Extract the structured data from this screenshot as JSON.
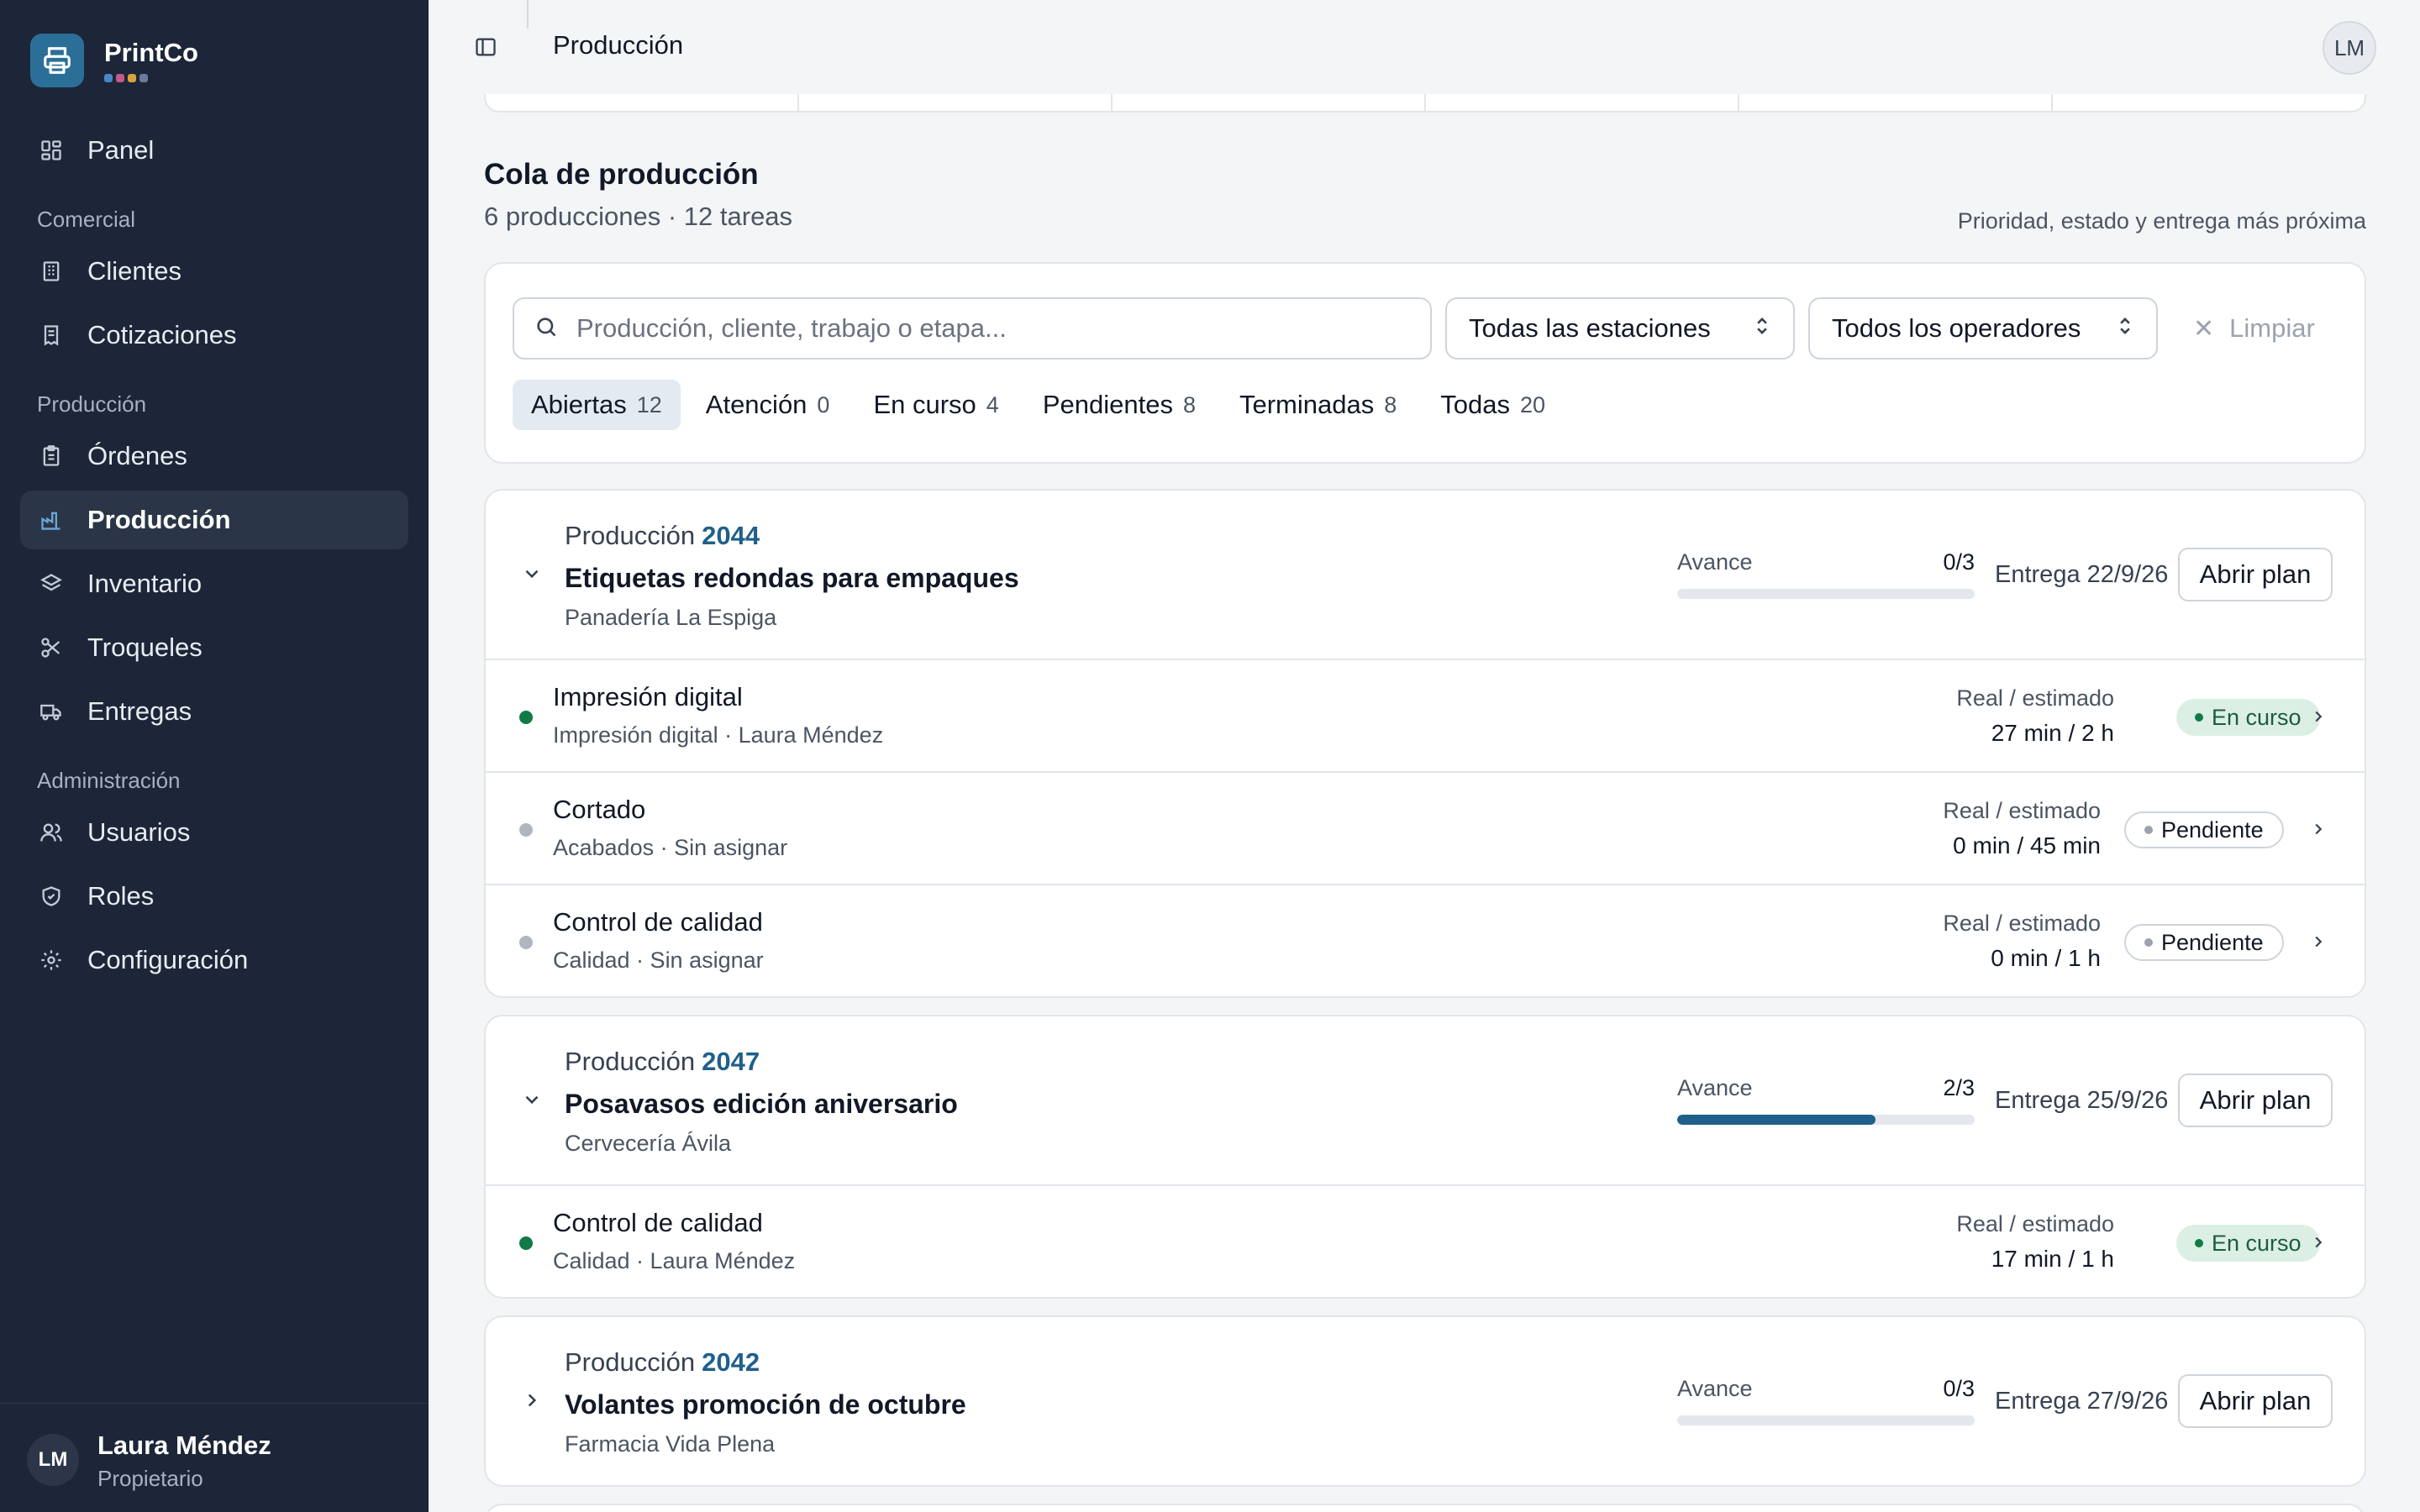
{
  "brand": {
    "name": "PrintCo",
    "dot_colors": [
      "#4a86c5",
      "#c55a8a",
      "#d9a23a",
      "#6b7c9a"
    ]
  },
  "nav": {
    "panel": "Panel",
    "section_comercial": "Comercial",
    "clientes": "Clientes",
    "cotizaciones": "Cotizaciones",
    "section_produccion": "Producción",
    "ordenes": "Órdenes",
    "produccion": "Producción",
    "inventario": "Inventario",
    "troqueles": "Troqueles",
    "entregas": "Entregas",
    "section_admin": "Administración",
    "usuarios": "Usuarios",
    "roles": "Roles",
    "configuracion": "Configuración"
  },
  "user": {
    "initials": "LM",
    "name": "Laura Méndez",
    "role": "Propietario"
  },
  "header": {
    "title": "Producción",
    "avatar_initials": "LM"
  },
  "queue": {
    "title": "Cola de producción",
    "subtitle": "6 producciones · 12 tareas",
    "sort_text": "Prioridad, estado y entrega más próxima"
  },
  "filters": {
    "search_placeholder": "Producción, cliente, trabajo o etapa...",
    "station": "Todas las estaciones",
    "operator": "Todos los operadores",
    "clear": "Limpiar",
    "tabs": [
      {
        "label": "Abiertas",
        "count": "12"
      },
      {
        "label": "Atención",
        "count": "0"
      },
      {
        "label": "En curso",
        "count": "4"
      },
      {
        "label": "Pendientes",
        "count": "8"
      },
      {
        "label": "Terminadas",
        "count": "8"
      },
      {
        "label": "Todas",
        "count": "20"
      }
    ]
  },
  "productions": [
    {
      "label": "Producción",
      "number": "2044",
      "name": "Etiquetas redondas para empaques",
      "client": "Panadería La Espiga",
      "progress_label": "Avance",
      "progress_text": "0/3",
      "progress": 0,
      "delivery": "Entrega 22/9/26",
      "open_label": "Abrir plan",
      "expanded": true,
      "tasks": [
        {
          "name": "Impresión digital",
          "meta": "Impresión digital · Laura Méndez",
          "time_label": "Real / estimado",
          "time_value": "27 min / 2 h",
          "status": "En curso"
        },
        {
          "name": "Cortado",
          "meta": "Acabados · Sin asignar",
          "time_label": "Real / estimado",
          "time_value": "0 min / 45 min",
          "status": "Pendiente"
        },
        {
          "name": "Control de calidad",
          "meta": "Calidad · Sin asignar",
          "time_label": "Real / estimado",
          "time_value": "0 min / 1 h",
          "status": "Pendiente"
        }
      ]
    },
    {
      "label": "Producción",
      "number": "2047",
      "name": "Posavasos edición aniversario",
      "client": "Cervecería Ávila",
      "progress_label": "Avance",
      "progress_text": "2/3",
      "progress": 0.667,
      "delivery": "Entrega 25/9/26",
      "open_label": "Abrir plan",
      "expanded": true,
      "tasks": [
        {
          "name": "Control de calidad",
          "meta": "Calidad · Laura Méndez",
          "time_label": "Real / estimado",
          "time_value": "17 min / 1 h",
          "status": "En curso"
        }
      ]
    },
    {
      "label": "Producción",
      "number": "2042",
      "name": "Volantes promoción de octubre",
      "client": "Farmacia Vida Plena",
      "progress_label": "Avance",
      "progress_text": "0/3",
      "progress": 0,
      "delivery": "Entrega 27/9/26",
      "open_label": "Abrir plan",
      "expanded": false,
      "tasks": []
    }
  ],
  "colors": {
    "accent": "#1f5f8b",
    "sidebar": "#1c2638",
    "running": "#117a46",
    "pending": "#9ca3af"
  }
}
